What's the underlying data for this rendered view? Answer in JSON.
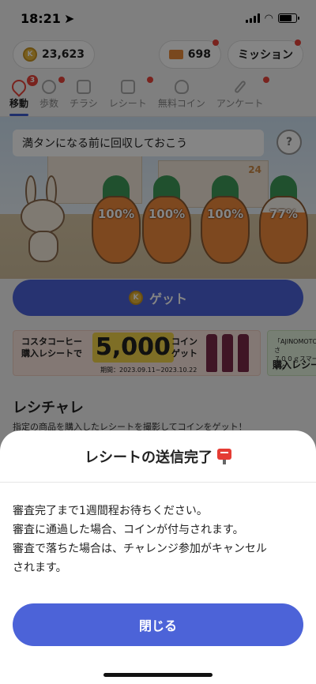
{
  "status_bar": {
    "time": "18:21"
  },
  "header": {
    "coin_balance": "23,623",
    "ticket_count": "698",
    "mission_label": "ミッション"
  },
  "tabs": [
    {
      "label": "移動",
      "badge": "3",
      "active": true
    },
    {
      "label": "歩数"
    },
    {
      "label": "チラシ"
    },
    {
      "label": "レシート"
    },
    {
      "label": "無料コイン"
    },
    {
      "label": "アンケート"
    }
  ],
  "move_panel": {
    "hint": "満タンになる前に回収しておこう",
    "help": "?",
    "carrots": [
      {
        "label": "100%",
        "fill": 1.0
      },
      {
        "label": "100%",
        "fill": 1.0
      },
      {
        "label": "100%",
        "fill": 1.0
      },
      {
        "label": "77%",
        "fill": 0.77
      }
    ],
    "building_number": "24",
    "get_label": "ゲット"
  },
  "banners": {
    "main": {
      "left_line1": "コスタコーヒー",
      "left_line2": "購入レシートで",
      "amount": "5,000",
      "coin_line1": "コイン",
      "coin_line2": "ゲット",
      "period": "期間：2023.09.11~2023.10.22"
    },
    "side": {
      "line1": "「AJINOMOTO さ",
      "line2": "７００ｇスマートク",
      "big": "購入レシー"
    }
  },
  "section": {
    "title": "レシチャレ",
    "subtitle": "指定の商品を購入したレシートを撮影してコインをゲット！"
  },
  "sheet": {
    "title": "レシートの送信完了",
    "lines": [
      "審査完了まで1週間程お待ちください。",
      "審査に通過した場合、コインが付与されます。",
      "審査で落ちた場合は、チャレンジ参加がキャンセル",
      "されます。"
    ],
    "close_label": "閉じる"
  }
}
